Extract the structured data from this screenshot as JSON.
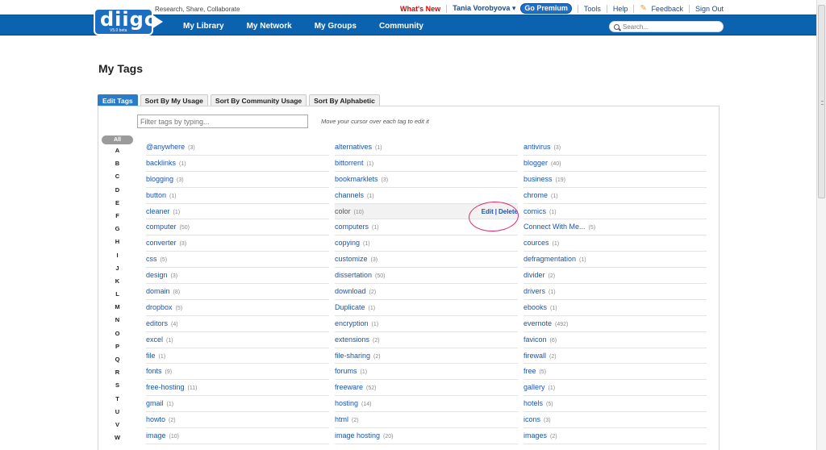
{
  "header": {
    "tagline": "Research, Share, Collaborate",
    "whats_new": "What's New",
    "user": "Tania Vorobyova ▾",
    "premium": "Go Premium",
    "tools": "Tools",
    "help": "Help",
    "feedback": "Feedback",
    "signout": "Sign Out"
  },
  "logo": {
    "word": "diigo",
    "version": "V5.0 beta"
  },
  "nav": [
    "My Library",
    "My Network",
    "My Groups",
    "Community"
  ],
  "search": {
    "placeholder": "Search..."
  },
  "page_title": "My Tags",
  "tabs": [
    "Edit Tags",
    "Sort By My Usage",
    "Sort By Community Usage",
    "Sort By Alphabetic"
  ],
  "filter": {
    "placeholder": "Filter tags by typing...",
    "hint": "Move your cursor over each tag to edit it"
  },
  "letters": {
    "all": "All",
    "items": [
      "A",
      "B",
      "C",
      "D",
      "E",
      "F",
      "G",
      "H",
      "I",
      "J",
      "K",
      "L",
      "M",
      "N",
      "O",
      "P",
      "Q",
      "R",
      "S",
      "T",
      "U",
      "V",
      "W"
    ]
  },
  "edit_actions": {
    "edit": "Edit",
    "delete": "Delete"
  },
  "columns": [
    [
      {
        "name": "@anywhere",
        "count": "(3)"
      },
      {
        "name": "backlinks",
        "count": "(1)"
      },
      {
        "name": "blogging",
        "count": "(3)"
      },
      {
        "name": "button",
        "count": "(1)"
      },
      {
        "name": "cleaner",
        "count": "(1)"
      },
      {
        "name": "computer",
        "count": "(50)"
      },
      {
        "name": "converter",
        "count": "(3)"
      },
      {
        "name": "css",
        "count": "(5)"
      },
      {
        "name": "design",
        "count": "(3)"
      },
      {
        "name": "domain",
        "count": "(8)"
      },
      {
        "name": "dropbox",
        "count": "(5)"
      },
      {
        "name": "editors",
        "count": "(4)"
      },
      {
        "name": "excel",
        "count": "(1)"
      },
      {
        "name": "file",
        "count": "(1)"
      },
      {
        "name": "fonts",
        "count": "(9)"
      },
      {
        "name": "free-hosting",
        "count": "(11)"
      },
      {
        "name": "gmail",
        "count": "(1)"
      },
      {
        "name": "howto",
        "count": "(2)"
      },
      {
        "name": "image",
        "count": "(10)"
      }
    ],
    [
      {
        "name": "alternatives",
        "count": "(1)"
      },
      {
        "name": "bittorrent",
        "count": "(1)"
      },
      {
        "name": "bookmarklets",
        "count": "(3)"
      },
      {
        "name": "channels",
        "count": "(1)"
      },
      {
        "name": "color",
        "count": "(10)",
        "hover": true
      },
      {
        "name": "computers",
        "count": "(1)"
      },
      {
        "name": "copying",
        "count": "(1)"
      },
      {
        "name": "customize",
        "count": "(3)"
      },
      {
        "name": "dissertation",
        "count": "(50)"
      },
      {
        "name": "download",
        "count": "(2)"
      },
      {
        "name": "Duplicate",
        "count": "(1)"
      },
      {
        "name": "encryption",
        "count": "(1)"
      },
      {
        "name": "extensions",
        "count": "(2)"
      },
      {
        "name": "file-sharing",
        "count": "(2)"
      },
      {
        "name": "forums",
        "count": "(1)"
      },
      {
        "name": "freeware",
        "count": "(52)"
      },
      {
        "name": "hosting",
        "count": "(14)"
      },
      {
        "name": "html",
        "count": "(2)"
      },
      {
        "name": "image hosting",
        "count": "(20)"
      }
    ],
    [
      {
        "name": "antivirus",
        "count": "(3)"
      },
      {
        "name": "blogger",
        "count": "(40)"
      },
      {
        "name": "business",
        "count": "(19)"
      },
      {
        "name": "chrome",
        "count": "(1)"
      },
      {
        "name": "comics",
        "count": "(1)"
      },
      {
        "name": "Connect With Me...",
        "count": "(5)"
      },
      {
        "name": "cources",
        "count": "(1)"
      },
      {
        "name": "defragmentation",
        "count": "(1)"
      },
      {
        "name": "divider",
        "count": "(2)"
      },
      {
        "name": "drivers",
        "count": "(1)"
      },
      {
        "name": "ebooks",
        "count": "(1)"
      },
      {
        "name": "evernote",
        "count": "(492)"
      },
      {
        "name": "favicon",
        "count": "(6)"
      },
      {
        "name": "firewall",
        "count": "(2)"
      },
      {
        "name": "free",
        "count": "(5)"
      },
      {
        "name": "gallery",
        "count": "(1)"
      },
      {
        "name": "hotels",
        "count": "(5)"
      },
      {
        "name": "icons",
        "count": "(3)"
      },
      {
        "name": "images",
        "count": "(2)"
      }
    ]
  ],
  "colors": {
    "nav_blue": "#0b63b0",
    "link_blue": "#1a55b0",
    "circle_pink": "#e22b72",
    "active_tab": "#2a7bc8"
  }
}
